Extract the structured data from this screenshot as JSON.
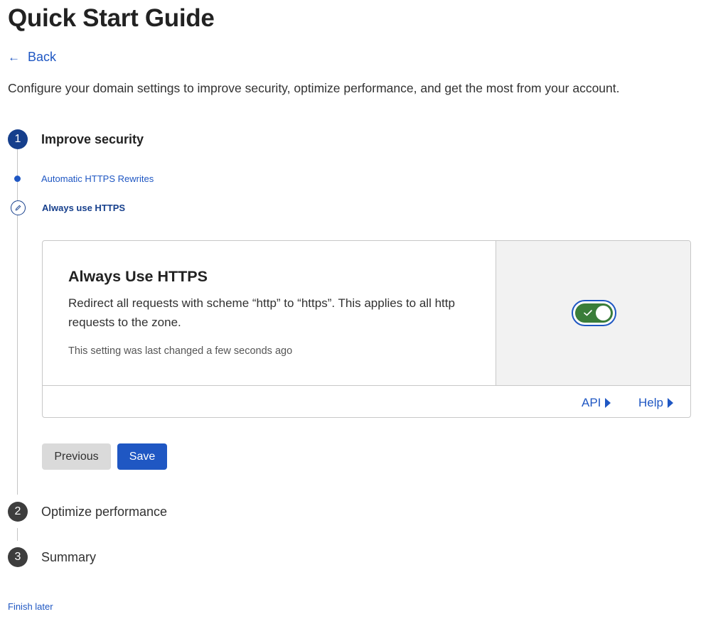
{
  "page": {
    "title": "Quick Start Guide",
    "back_label": "Back",
    "intro": "Configure your domain settings to improve security, optimize performance, and get the most from your account.",
    "finish_later": "Finish later"
  },
  "steps": [
    {
      "number": "1",
      "label": "Improve security",
      "state": "active"
    },
    {
      "number": "2",
      "label": "Optimize performance",
      "state": "inactive"
    },
    {
      "number": "3",
      "label": "Summary",
      "state": "inactive"
    }
  ],
  "substeps": [
    {
      "label": "Automatic HTTPS Rewrites",
      "state": "completed"
    },
    {
      "label": "Always use HTTPS",
      "state": "current"
    }
  ],
  "setting_card": {
    "title": "Always Use HTTPS",
    "description": "Redirect all requests with scheme “http” to “https”. This applies to all http requests to the zone.",
    "last_changed": "This setting was last changed a few seconds ago",
    "toggle_on": true,
    "api_label": "API",
    "help_label": "Help"
  },
  "buttons": {
    "previous": "Previous",
    "save": "Save"
  },
  "colors": {
    "link": "#1f57c3",
    "active_step": "#163f8c",
    "inactive_step": "#3d3d3d",
    "toggle_on": "#3a7d3a",
    "side_panel": "#f2f2f2"
  },
  "icons": {
    "back": "arrow-left-icon",
    "substep_current": "pencil-icon",
    "toggle": "check-icon",
    "link": "caret-right-icon"
  }
}
